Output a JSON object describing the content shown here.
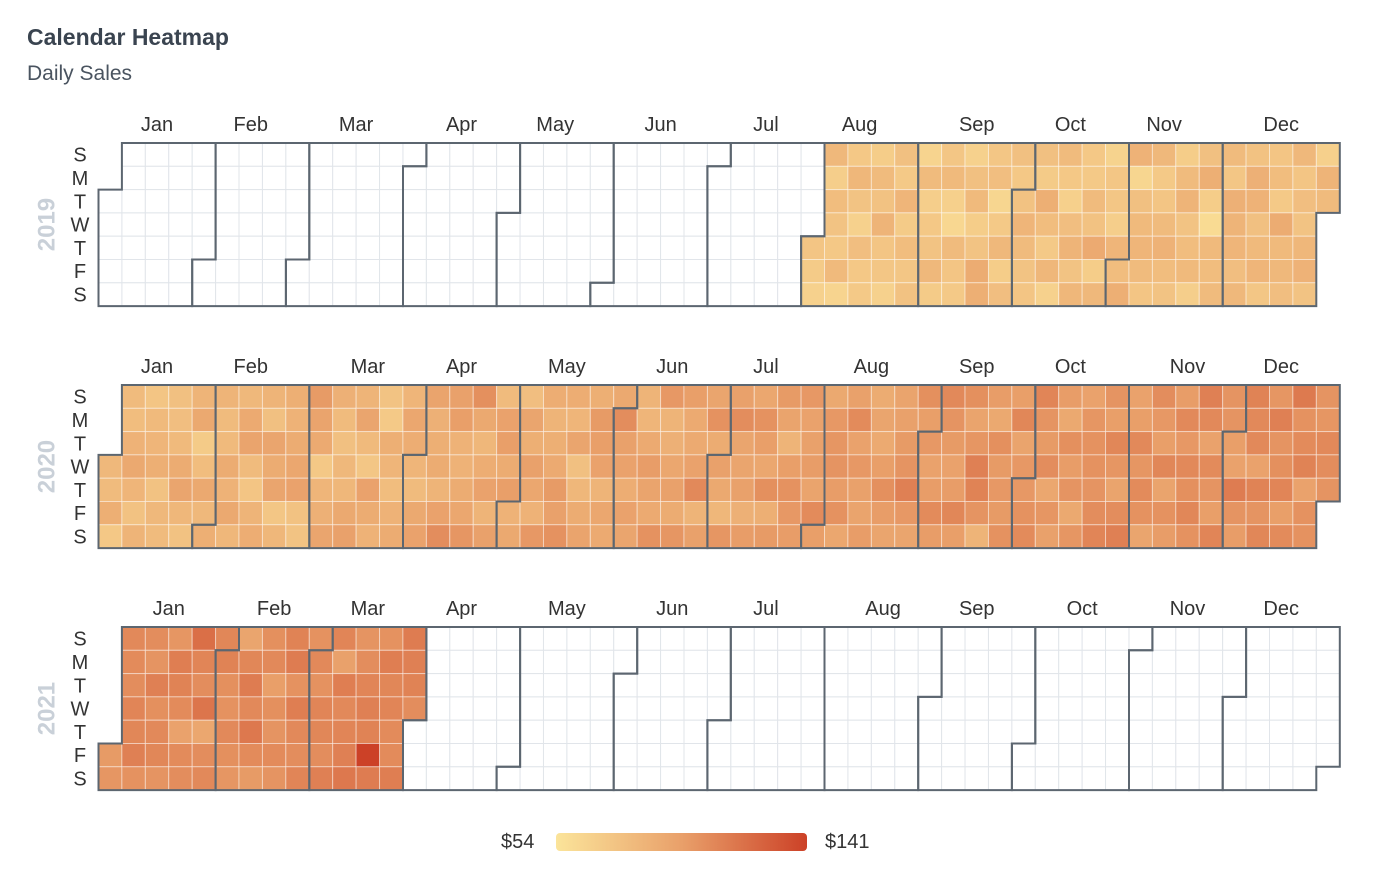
{
  "header": {
    "title": "Calendar Heatmap",
    "subtitle": "Daily Sales"
  },
  "legend": {
    "min_label": "$54",
    "max_label": "$141",
    "color_low": "#fbe49a",
    "color_mid": "#e9a06a",
    "color_high": "#cc4127"
  },
  "chart_data": {
    "type": "heatmap",
    "title": "Calendar Heatmap",
    "subtitle": "Daily Sales",
    "value_range": [
      54,
      141
    ],
    "value_unit": "$",
    "weekday_labels": [
      "S",
      "M",
      "T",
      "W",
      "T",
      "F",
      "S"
    ],
    "month_labels": [
      "Jan",
      "Feb",
      "Mar",
      "Apr",
      "May",
      "Jun",
      "Jul",
      "Aug",
      "Sep",
      "Oct",
      "Nov",
      "Dec"
    ],
    "years": [
      {
        "year": 2019,
        "start_date": "2019-08-01",
        "end_date": "2019-12-31",
        "values": [
          74,
          70,
          66,
          82,
          68,
          79,
          75,
          72,
          81,
          64,
          72,
          83,
          75,
          66,
          78,
          72,
          71,
          69,
          80,
          76,
          85,
          74,
          73,
          66,
          77,
          71,
          84,
          70,
          79,
          73,
          76,
          64,
          80,
          68,
          72,
          75,
          82,
          70,
          73,
          81,
          67,
          62,
          80,
          74,
          71,
          66,
          77,
          81,
          69,
          75,
          90,
          88,
          73,
          78,
          63,
          71,
          82,
          69,
          78,
          77,
          72,
          76,
          84,
          80,
          75,
          74,
          77,
          70,
          88,
          79,
          71,
          83,
          66,
          80,
          72,
          67,
          78,
          85,
          75,
          83,
          72,
          71,
          80,
          76,
          91,
          69,
          82,
          65,
          73,
          73,
          68,
          84,
          79,
          88,
          86,
          63,
          77,
          81,
          84,
          80,
          74,
          82,
          71,
          74,
          80,
          86,
          79,
          75,
          69,
          80,
          85,
          75,
          79,
          81,
          68,
          77,
          88,
          69,
          60,
          81,
          79,
          80,
          80,
          73,
          87,
          85,
          84,
          78,
          82,
          76,
          87,
          86,
          77,
          81,
          84,
          73,
          74,
          79,
          71,
          90,
          81,
          82,
          78,
          82,
          74,
          78,
          75,
          83,
          86,
          75,
          67,
          85,
          80
        ]
      },
      {
        "year": 2020,
        "start_date": "2020-01-01",
        "end_date": "2020-12-31",
        "values": [
          82,
          80,
          88,
          72,
          80,
          79,
          86,
          92,
          84,
          76,
          85,
          74,
          81,
          84,
          88,
          76,
          82,
          80,
          77,
          78,
          81,
          90,
          94,
          83,
          76,
          85,
          92,
          70,
          79,
          92,
          82,
          88,
          85,
          80,
          81,
          90,
          86,
          92,
          83,
          82,
          91,
          95,
          80,
          74,
          85,
          89,
          85,
          77,
          94,
          90,
          94,
          73,
          83,
          88,
          86,
          90,
          93,
          96,
          76,
          75,
          100,
          95,
          91,
          72,
          84,
          87,
          94,
          87,
          80,
          77,
          82,
          83,
          92,
          97,
          85,
          94,
          81,
          73,
          96,
          90,
          86,
          75,
          71,
          88,
          84,
          79,
          86,
          90,
          84,
          93,
          89,
          84,
          80,
          92,
          96,
          95,
          87,
          88,
          90,
          85,
          96,
          106,
          97,
          98,
          86,
          86,
          90,
          93,
          102,
          105,
          92,
          83,
          89,
          96,
          85,
          97,
          80,
          96,
          98,
          90,
          98,
          86,
          92,
          78,
          94,
          88,
          97,
          93,
          86,
          101,
          89,
          85,
          88,
          91,
          100,
          97,
          104,
          89,
          84,
          94,
          77,
          83,
          90,
          95,
          88,
          100,
          98,
          96,
          85,
          93,
          91,
          92,
          106,
          97,
          96,
          89,
          96,
          94,
          85,
          84,
          91,
          99,
          95,
          91,
          104,
          101,
          85,
          87,
          93,
          97,
          90,
          102,
          98,
          91,
          91,
          96,
          108,
          85,
          97,
          94,
          104,
          90,
          97,
          92,
          83,
          102,
          97,
          106,
          94,
          94,
          97,
          87,
          99,
          93,
          104,
          98,
          93,
          105,
          88,
          100,
          100,
          95,
          85,
          98,
          104,
          101,
          99,
          101,
          96,
          97,
          99,
          95,
          107,
          98,
          92,
          101,
          102,
          103,
          99,
          104,
          93,
          97,
          107,
          96,
          101,
          97,
          95,
          99,
          90,
          94,
          91,
          98,
          105,
          99,
          94,
          95,
          97,
          100,
          103,
          112,
          101,
          94,
          105,
          98,
          101,
          96,
          99,
          107,
          99,
          108,
          103,
          100,
          96,
          99,
          109,
          98,
          105,
          95,
          102,
          112,
          111,
          103,
          85,
          99,
          92,
          105,
          100,
          101,
          100,
          104,
          98,
          109,
          95,
          101,
          101,
          104,
          107,
          110,
          103,
          100,
          106,
          93,
          102,
          97,
          99,
          92,
          105,
          99,
          103,
          92,
          102,
          96,
          102,
          104,
          104,
          103,
          106,
          110,
          103,
          98,
          109,
          102,
          95,
          106,
          112,
          96,
          98,
          108,
          102,
          107,
          104,
          94,
          106,
          101,
          98,
          109,
          95,
          104,
          99,
          99,
          108,
          101,
          108,
          105,
          109,
          104,
          112,
          108,
          96,
          107,
          103,
          98,
          110,
          103,
          103,
          98,
          96,
          114,
          103,
          99,
          111,
          108,
          108,
          96,
          111,
          103,
          109,
          102,
          112,
          103,
          105,
          110,
          98,
          107,
          115,
          104,
          107,
          111,
          96,
          104,
          104,
          103,
          102,
          108,
          106,
          103,
          112,
          100,
          104,
          112
        ]
      },
      {
        "year": 2021,
        "start_date": "2021-01-01",
        "end_date": "2021-03-31",
        "values": [
          100,
          102,
          108,
          107,
          106,
          110,
          109,
          112,
          104,
          106,
          103,
          112,
          105,
          108,
          109,
          103,
          102,
          113,
          111,
          107,
          96,
          107,
          106,
          120,
          110,
          106,
          117,
          93,
          106,
          108,
          109,
          111,
          105,
          104,
          108,
          105,
          102,
          94,
          109,
          114,
          108,
          116,
          107,
          100,
          105,
          108,
          98,
          105,
          103,
          107,
          103,
          111,
          114,
          104,
          113,
          108,
          106,
          110,
          104,
          108,
          104,
          110,
          109,
          106,
          112,
          110,
          97,
          113,
          108,
          110,
          112,
          116,
          103,
          106,
          110,
          112,
          111,
          141,
          114,
          104,
          113,
          109,
          110,
          107,
          107,
          113,
          114,
          112,
          111,
          106
        ]
      }
    ]
  }
}
